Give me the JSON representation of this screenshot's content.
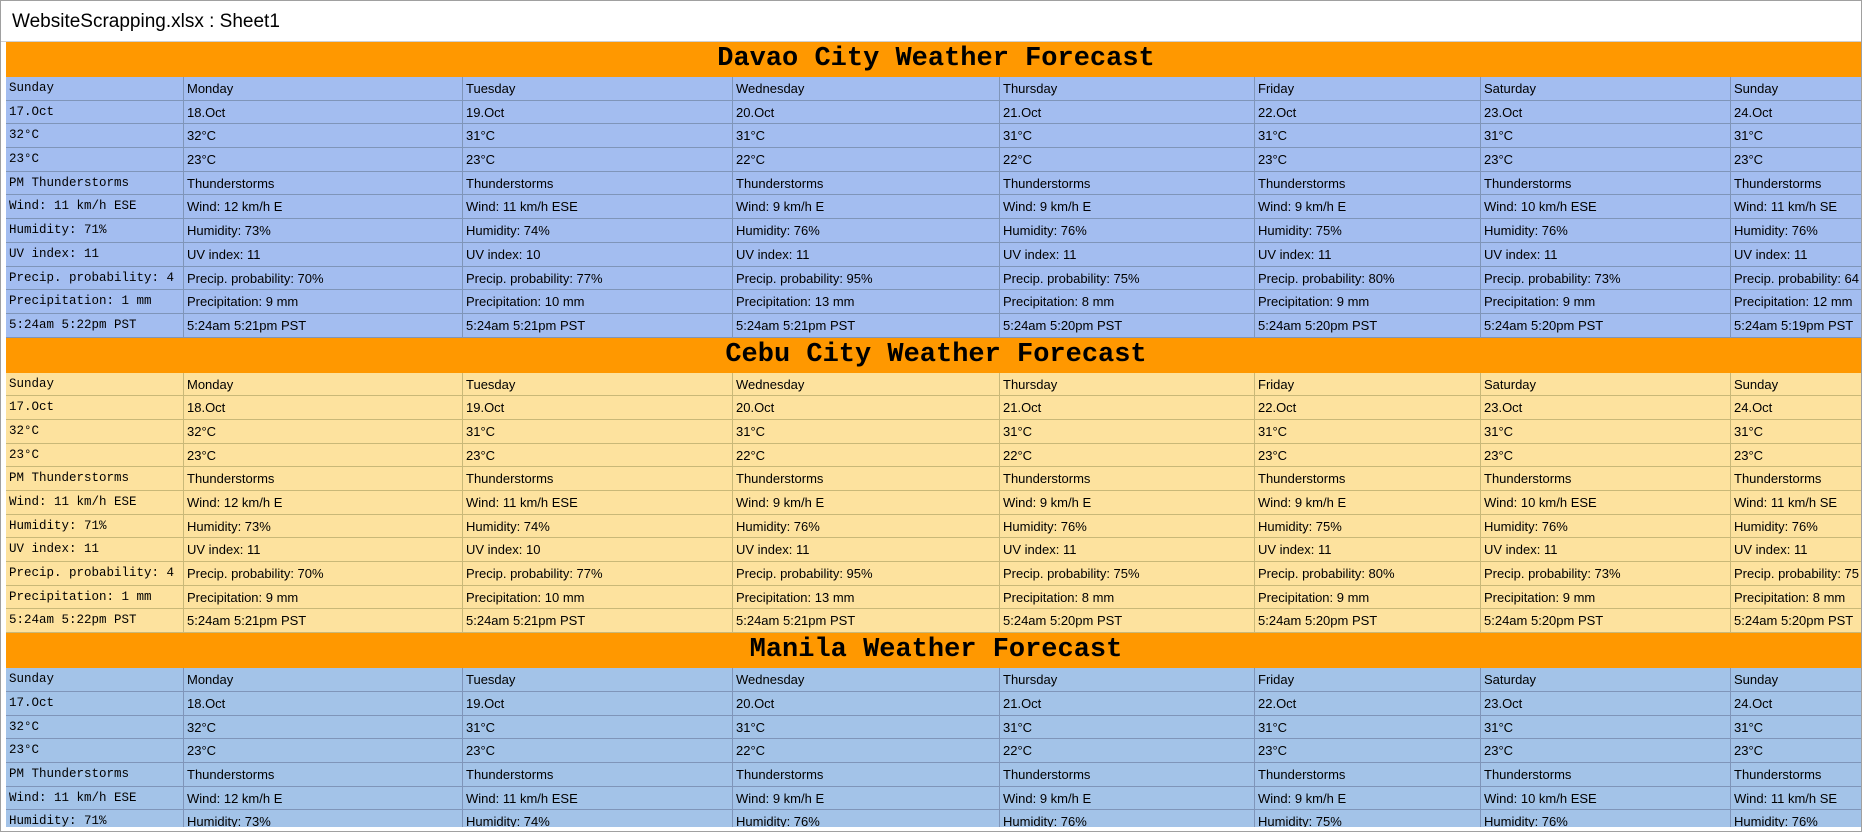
{
  "window": {
    "title": "WebsiteScrapping.xlsx : Sheet1"
  },
  "colors": {
    "header_bg": "#ff9800",
    "davao_bg": "#a3bdf0",
    "cebu_bg": "#fde29e",
    "manila_bg": "#a3c3e8"
  },
  "cities": [
    {
      "key": "davao",
      "title": "Davao City Weather Forecast",
      "rows": [
        [
          "Sunday",
          "Monday",
          "Tuesday",
          "Wednesday",
          "Thursday",
          "Friday",
          "Saturday",
          "Sunday"
        ],
        [
          "17.Oct",
          "18.Oct",
          "19.Oct",
          "20.Oct",
          "21.Oct",
          "22.Oct",
          "23.Oct",
          "24.Oct"
        ],
        [
          "32°C",
          "32°C",
          "31°C",
          "31°C",
          "31°C",
          "31°C",
          "31°C",
          "31°C"
        ],
        [
          "23°C",
          "23°C",
          "23°C",
          "22°C",
          "22°C",
          "23°C",
          "23°C",
          "23°C"
        ],
        [
          "PM Thunderstorms",
          "Thunderstorms",
          "Thunderstorms",
          "Thunderstorms",
          "Thunderstorms",
          "Thunderstorms",
          "Thunderstorms",
          "Thunderstorms"
        ],
        [
          "Wind: 11 km/h ESE",
          "Wind: 12 km/h E",
          "Wind: 11 km/h ESE",
          "Wind: 9 km/h E",
          "Wind: 9 km/h E",
          "Wind: 9 km/h E",
          "Wind: 10 km/h ESE",
          "Wind: 11 km/h SE"
        ],
        [
          "Humidity: 71%",
          "Humidity: 73%",
          "Humidity: 74%",
          "Humidity: 76%",
          "Humidity: 76%",
          "Humidity: 75%",
          "Humidity: 76%",
          "Humidity: 76%"
        ],
        [
          "UV index: 11",
          "UV index: 11",
          "UV index: 10",
          "UV index: 11",
          "UV index: 11",
          "UV index: 11",
          "UV index: 11",
          "UV index: 11"
        ],
        [
          "Precip. probability: 4",
          "Precip. probability: 70%",
          "Precip. probability: 77%",
          "Precip. probability: 95%",
          "Precip. probability: 75%",
          "Precip. probability: 80%",
          "Precip. probability: 73%",
          "Precip. probability: 64"
        ],
        [
          "Precipitation: 1 mm",
          "Precipitation: 9 mm",
          "Precipitation: 10 mm",
          "Precipitation: 13 mm",
          "Precipitation: 8 mm",
          "Precipitation: 9 mm",
          "Precipitation: 9 mm",
          "Precipitation: 12 mm"
        ],
        [
          "5:24am 5:22pm PST",
          "5:24am 5:21pm PST",
          "5:24am 5:21pm PST",
          "5:24am 5:21pm PST",
          "5:24am 5:20pm PST",
          "5:24am 5:20pm PST",
          "5:24am 5:20pm PST",
          "5:24am 5:19pm PST"
        ]
      ]
    },
    {
      "key": "cebu",
      "title": "Cebu City Weather Forecast",
      "rows": [
        [
          "Sunday",
          "Monday",
          "Tuesday",
          "Wednesday",
          "Thursday",
          "Friday",
          "Saturday",
          "Sunday"
        ],
        [
          "17.Oct",
          "18.Oct",
          "19.Oct",
          "20.Oct",
          "21.Oct",
          "22.Oct",
          "23.Oct",
          "24.Oct"
        ],
        [
          "32°C",
          "32°C",
          "31°C",
          "31°C",
          "31°C",
          "31°C",
          "31°C",
          "31°C"
        ],
        [
          "23°C",
          "23°C",
          "23°C",
          "22°C",
          "22°C",
          "23°C",
          "23°C",
          "23°C"
        ],
        [
          "PM Thunderstorms",
          "Thunderstorms",
          "Thunderstorms",
          "Thunderstorms",
          "Thunderstorms",
          "Thunderstorms",
          "Thunderstorms",
          "Thunderstorms"
        ],
        [
          "Wind: 11 km/h ESE",
          "Wind: 12 km/h E",
          "Wind: 11 km/h ESE",
          "Wind: 9 km/h E",
          "Wind: 9 km/h E",
          "Wind: 9 km/h E",
          "Wind: 10 km/h ESE",
          "Wind: 11 km/h SE"
        ],
        [
          "Humidity: 71%",
          "Humidity: 73%",
          "Humidity: 74%",
          "Humidity: 76%",
          "Humidity: 76%",
          "Humidity: 75%",
          "Humidity: 76%",
          "Humidity: 76%"
        ],
        [
          "UV index: 11",
          "UV index: 11",
          "UV index: 10",
          "UV index: 11",
          "UV index: 11",
          "UV index: 11",
          "UV index: 11",
          "UV index: 11"
        ],
        [
          "Precip. probability: 4",
          "Precip. probability: 70%",
          "Precip. probability: 77%",
          "Precip. probability: 95%",
          "Precip. probability: 75%",
          "Precip. probability: 80%",
          "Precip. probability: 73%",
          "Precip. probability: 75"
        ],
        [
          "Precipitation: 1 mm",
          "Precipitation: 9 mm",
          "Precipitation: 10 mm",
          "Precipitation: 13 mm",
          "Precipitation: 8 mm",
          "Precipitation: 9 mm",
          "Precipitation: 9 mm",
          "Precipitation: 8 mm"
        ],
        [
          "5:24am 5:22pm PST",
          "5:24am 5:21pm PST",
          "5:24am 5:21pm PST",
          "5:24am 5:21pm PST",
          "5:24am 5:20pm PST",
          "5:24am 5:20pm PST",
          "5:24am 5:20pm PST",
          "5:24am 5:20pm PST"
        ]
      ]
    },
    {
      "key": "manila",
      "title": "Manila Weather Forecast",
      "rows": [
        [
          "Sunday",
          "Monday",
          "Tuesday",
          "Wednesday",
          "Thursday",
          "Friday",
          "Saturday",
          "Sunday"
        ],
        [
          "17.Oct",
          "18.Oct",
          "19.Oct",
          "20.Oct",
          "21.Oct",
          "22.Oct",
          "23.Oct",
          "24.Oct"
        ],
        [
          "32°C",
          "32°C",
          "31°C",
          "31°C",
          "31°C",
          "31°C",
          "31°C",
          "31°C"
        ],
        [
          "23°C",
          "23°C",
          "23°C",
          "22°C",
          "22°C",
          "23°C",
          "23°C",
          "23°C"
        ],
        [
          "PM Thunderstorms",
          "Thunderstorms",
          "Thunderstorms",
          "Thunderstorms",
          "Thunderstorms",
          "Thunderstorms",
          "Thunderstorms",
          "Thunderstorms"
        ],
        [
          "Wind: 11 km/h ESE",
          "Wind: 12 km/h E",
          "Wind: 11 km/h ESE",
          "Wind: 9 km/h E",
          "Wind: 9 km/h E",
          "Wind: 9 km/h E",
          "Wind: 10 km/h ESE",
          "Wind: 11 km/h SE"
        ],
        [
          "Humidity: 71%",
          "Humidity: 73%",
          "Humidity: 74%",
          "Humidity: 76%",
          "Humidity: 76%",
          "Humidity: 75%",
          "Humidity: 76%",
          "Humidity: 76%"
        ]
      ]
    }
  ]
}
